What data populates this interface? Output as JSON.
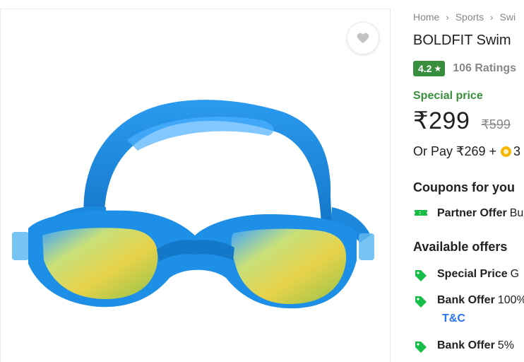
{
  "breadcrumb": [
    "Home",
    "Sports",
    "Swi"
  ],
  "product": {
    "title": "BOLDFIT Swim",
    "rating": "4.2",
    "ratings_count": "106 Ratings",
    "special_price_label": "Special price",
    "price": "₹299",
    "mrp": "₹599",
    "or_pay_prefix": "Or Pay ₹269 +",
    "coins": "3"
  },
  "coupons": {
    "heading": "Coupons for you",
    "items": [
      {
        "kind": "Partner Offer",
        "desc": "Bu"
      }
    ]
  },
  "offers": {
    "heading": "Available offers",
    "items": [
      {
        "kind": "Special Price",
        "desc": "G"
      },
      {
        "kind": "Bank Offer",
        "desc": "100%"
      },
      {
        "kind": "Bank Offer",
        "desc": "5%"
      }
    ],
    "tnc": "T&C"
  },
  "colors": {
    "rating_green": "#388e3c",
    "link_blue": "#2874f0",
    "muted_grey": "#878787"
  },
  "icons": [
    "heart-icon",
    "star-icon",
    "ticket-icon",
    "offer-tag-icon",
    "supercoin-icon",
    "chevron-right-icon"
  ]
}
